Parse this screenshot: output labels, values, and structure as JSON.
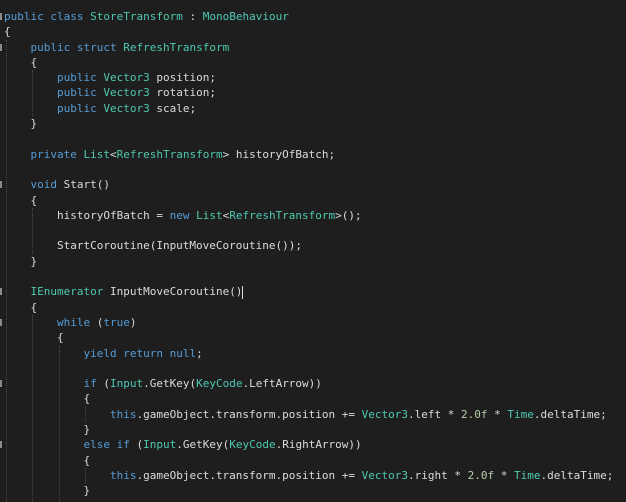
{
  "editor": {
    "language": "C#",
    "colors": {
      "background": "#1e1e1e",
      "keyword": "#569cd6",
      "type": "#4ec9b0",
      "text": "#dcdcdc",
      "number": "#b5cea8"
    },
    "lines": [
      [
        {
          "t": "kw",
          "v": "public"
        },
        {
          "t": "plain",
          "v": " "
        },
        {
          "t": "kw",
          "v": "class"
        },
        {
          "t": "plain",
          "v": " "
        },
        {
          "t": "type",
          "v": "StoreTransform"
        },
        {
          "t": "plain",
          "v": " : "
        },
        {
          "t": "type",
          "v": "MonoBehaviour"
        }
      ],
      [
        {
          "t": "plain",
          "v": "{"
        }
      ],
      [
        {
          "t": "plain",
          "v": "    "
        },
        {
          "t": "kw",
          "v": "public"
        },
        {
          "t": "plain",
          "v": " "
        },
        {
          "t": "kw",
          "v": "struct"
        },
        {
          "t": "plain",
          "v": " "
        },
        {
          "t": "type",
          "v": "RefreshTransform"
        }
      ],
      [
        {
          "t": "plain",
          "v": "    {"
        }
      ],
      [
        {
          "t": "plain",
          "v": "        "
        },
        {
          "t": "kw",
          "v": "public"
        },
        {
          "t": "plain",
          "v": " "
        },
        {
          "t": "type",
          "v": "Vector3"
        },
        {
          "t": "plain",
          "v": " position;"
        }
      ],
      [
        {
          "t": "plain",
          "v": "        "
        },
        {
          "t": "kw",
          "v": "public"
        },
        {
          "t": "plain",
          "v": " "
        },
        {
          "t": "type",
          "v": "Vector3"
        },
        {
          "t": "plain",
          "v": " rotation;"
        }
      ],
      [
        {
          "t": "plain",
          "v": "        "
        },
        {
          "t": "kw",
          "v": "public"
        },
        {
          "t": "plain",
          "v": " "
        },
        {
          "t": "type",
          "v": "Vector3"
        },
        {
          "t": "plain",
          "v": " scale;"
        }
      ],
      [
        {
          "t": "plain",
          "v": "    }"
        }
      ],
      [
        {
          "t": "plain",
          "v": ""
        }
      ],
      [
        {
          "t": "plain",
          "v": "    "
        },
        {
          "t": "kw",
          "v": "private"
        },
        {
          "t": "plain",
          "v": " "
        },
        {
          "t": "type",
          "v": "List"
        },
        {
          "t": "plain",
          "v": "<"
        },
        {
          "t": "type",
          "v": "RefreshTransform"
        },
        {
          "t": "plain",
          "v": "> historyOfBatch;"
        }
      ],
      [
        {
          "t": "plain",
          "v": ""
        }
      ],
      [
        {
          "t": "plain",
          "v": "    "
        },
        {
          "t": "kw",
          "v": "void"
        },
        {
          "t": "plain",
          "v": " Start()"
        }
      ],
      [
        {
          "t": "plain",
          "v": "    {"
        }
      ],
      [
        {
          "t": "plain",
          "v": "        historyOfBatch = "
        },
        {
          "t": "kw",
          "v": "new"
        },
        {
          "t": "plain",
          "v": " "
        },
        {
          "t": "type",
          "v": "List"
        },
        {
          "t": "plain",
          "v": "<"
        },
        {
          "t": "type",
          "v": "RefreshTransform"
        },
        {
          "t": "plain",
          "v": ">();"
        }
      ],
      [
        {
          "t": "plain",
          "v": ""
        }
      ],
      [
        {
          "t": "plain",
          "v": "        StartCoroutine(InputMoveCoroutine());"
        }
      ],
      [
        {
          "t": "plain",
          "v": "    }"
        }
      ],
      [
        {
          "t": "plain",
          "v": ""
        }
      ],
      [
        {
          "t": "plain",
          "v": "    "
        },
        {
          "t": "type",
          "v": "IEnumerator"
        },
        {
          "t": "plain",
          "v": " InputMoveCoroutine()"
        }
      ],
      [
        {
          "t": "plain",
          "v": "    {"
        }
      ],
      [
        {
          "t": "plain",
          "v": "        "
        },
        {
          "t": "kw",
          "v": "while"
        },
        {
          "t": "plain",
          "v": " ("
        },
        {
          "t": "kw",
          "v": "true"
        },
        {
          "t": "plain",
          "v": ")"
        }
      ],
      [
        {
          "t": "plain",
          "v": "        {"
        }
      ],
      [
        {
          "t": "plain",
          "v": "            "
        },
        {
          "t": "kw",
          "v": "yield"
        },
        {
          "t": "plain",
          "v": " "
        },
        {
          "t": "kw",
          "v": "return"
        },
        {
          "t": "plain",
          "v": " "
        },
        {
          "t": "kw",
          "v": "null"
        },
        {
          "t": "plain",
          "v": ";"
        }
      ],
      [
        {
          "t": "plain",
          "v": ""
        }
      ],
      [
        {
          "t": "plain",
          "v": "            "
        },
        {
          "t": "kw",
          "v": "if"
        },
        {
          "t": "plain",
          "v": " ("
        },
        {
          "t": "type",
          "v": "Input"
        },
        {
          "t": "plain",
          "v": ".GetKey("
        },
        {
          "t": "type",
          "v": "KeyCode"
        },
        {
          "t": "plain",
          "v": ".LeftArrow))"
        }
      ],
      [
        {
          "t": "plain",
          "v": "            {"
        }
      ],
      [
        {
          "t": "plain",
          "v": "                "
        },
        {
          "t": "kw",
          "v": "this"
        },
        {
          "t": "plain",
          "v": ".gameObject.transform.position += "
        },
        {
          "t": "type",
          "v": "Vector3"
        },
        {
          "t": "plain",
          "v": ".left * "
        },
        {
          "t": "num",
          "v": "2.0f"
        },
        {
          "t": "plain",
          "v": " * "
        },
        {
          "t": "type",
          "v": "Time"
        },
        {
          "t": "plain",
          "v": ".deltaTime;"
        }
      ],
      [
        {
          "t": "plain",
          "v": "            }"
        }
      ],
      [
        {
          "t": "plain",
          "v": "            "
        },
        {
          "t": "kw",
          "v": "else"
        },
        {
          "t": "plain",
          "v": " "
        },
        {
          "t": "kw",
          "v": "if"
        },
        {
          "t": "plain",
          "v": " ("
        },
        {
          "t": "type",
          "v": "Input"
        },
        {
          "t": "plain",
          "v": ".GetKey("
        },
        {
          "t": "type",
          "v": "KeyCode"
        },
        {
          "t": "plain",
          "v": ".RightArrow))"
        }
      ],
      [
        {
          "t": "plain",
          "v": "            {"
        }
      ],
      [
        {
          "t": "plain",
          "v": "                "
        },
        {
          "t": "kw",
          "v": "this"
        },
        {
          "t": "plain",
          "v": ".gameObject.transform.position += "
        },
        {
          "t": "type",
          "v": "Vector3"
        },
        {
          "t": "plain",
          "v": ".right * "
        },
        {
          "t": "num",
          "v": "2.0f"
        },
        {
          "t": "plain",
          "v": " * "
        },
        {
          "t": "type",
          "v": "Time"
        },
        {
          "t": "plain",
          "v": ".deltaTime;"
        }
      ],
      [
        {
          "t": "plain",
          "v": "            }"
        }
      ]
    ]
  }
}
